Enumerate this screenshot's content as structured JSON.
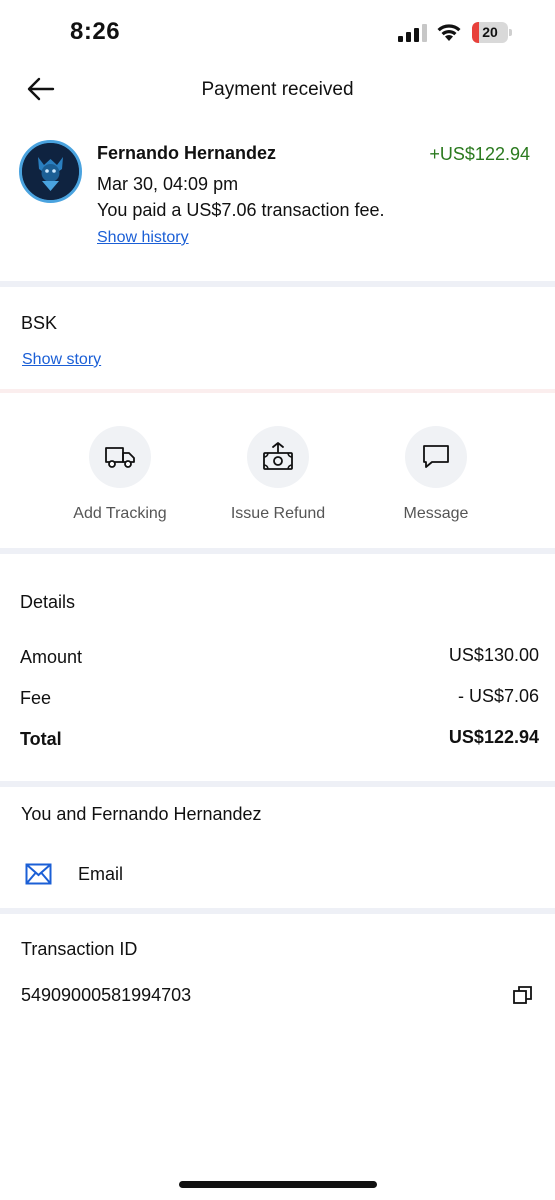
{
  "status_bar": {
    "time": "8:26",
    "battery_level": "20",
    "battery_fraction": 0.2,
    "battery_color": "#e8413b"
  },
  "header": {
    "title": "Payment received",
    "back_icon": "arrow-left-icon"
  },
  "payer": {
    "name": "Fernando Hernandez",
    "amount": "+US$122.94",
    "amount_color": "#2b7a1f",
    "date": "Mar 30, 04:09 pm",
    "fee_note": "You paid a US$7.06 transaction fee.",
    "show_history": "Show history"
  },
  "note": {
    "text": "BSK",
    "show_story": "Show story"
  },
  "actions": [
    {
      "label": "Add Tracking",
      "icon": "truck-icon"
    },
    {
      "label": "Issue Refund",
      "icon": "refund-cash-icon"
    },
    {
      "label": "Message",
      "icon": "chat-bubble-icon"
    }
  ],
  "details": {
    "title": "Details",
    "rows": [
      {
        "label": "Amount",
        "value": "US$130.00"
      },
      {
        "label": "Fee",
        "value": "- US$7.06"
      },
      {
        "label": "Total",
        "value": "US$122.94"
      }
    ]
  },
  "contact": {
    "title": "You and Fernando Hernandez",
    "email_label": "Email",
    "email_icon": "envelope-icon"
  },
  "transaction": {
    "title": "Transaction ID",
    "id": "54909000581994703",
    "copy_icon": "copy-icon"
  },
  "colors": {
    "link": "#1b5fd6",
    "divider": "#eef0f6",
    "action_circle": "#f0f2f5"
  }
}
